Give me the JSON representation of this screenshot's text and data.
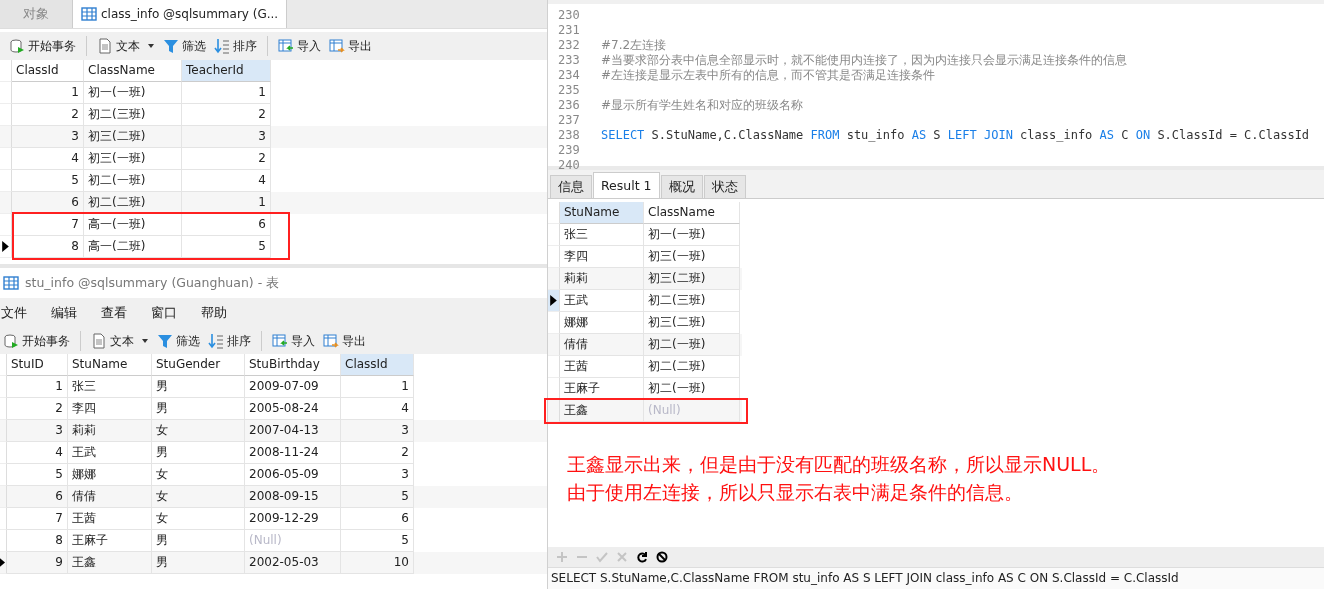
{
  "object_tabs": [
    {
      "label": "对象",
      "kind": "plain",
      "selected": false
    },
    {
      "label": "class_info @sqlsummary (G...",
      "kind": "table",
      "selected": true
    }
  ],
  "class_window": {
    "toolbar": [
      {
        "label": "开始事务",
        "kind": "transaction"
      },
      {
        "label": "文本",
        "kind": "text"
      },
      {
        "label": "筛选",
        "kind": "filter"
      },
      {
        "label": "排序",
        "kind": "sort"
      },
      {
        "label": "导入",
        "kind": "import"
      },
      {
        "label": "导出",
        "kind": "export"
      }
    ],
    "grid": {
      "columns": [
        {
          "name": "ClassId",
          "numeric": true,
          "selected": false
        },
        {
          "name": "ClassName",
          "numeric": false,
          "selected": false
        },
        {
          "name": "TeacherId",
          "numeric": true,
          "selected": true
        }
      ],
      "rows": [
        {
          "cells": [
            "1",
            "初一(一班)",
            "1"
          ],
          "selected": false,
          "highlighted": false
        },
        {
          "cells": [
            "2",
            "初二(三班)",
            "2"
          ],
          "selected": false,
          "highlighted": false
        },
        {
          "cells": [
            "3",
            "初三(二班)",
            "3"
          ],
          "selected": false,
          "highlighted": false
        },
        {
          "cells": [
            "4",
            "初三(一班)",
            "2"
          ],
          "selected": false,
          "highlighted": false
        },
        {
          "cells": [
            "5",
            "初二(一班)",
            "4"
          ],
          "selected": false,
          "highlighted": false
        },
        {
          "cells": [
            "6",
            "初二(二班)",
            "1"
          ],
          "selected": false,
          "highlighted": false
        },
        {
          "cells": [
            "7",
            "高一(一班)",
            "6"
          ],
          "selected": false,
          "highlighted": true
        },
        {
          "cells": [
            "8",
            "高一(二班)",
            "5"
          ],
          "selected": true,
          "highlighted": true
        }
      ]
    }
  },
  "stu_window": {
    "title": "stu_info @sqlsummary (Guanghuan) - 表",
    "menu": [
      "文件",
      "编辑",
      "查看",
      "窗口",
      "帮助"
    ],
    "toolbar": [
      {
        "label": "开始事务",
        "kind": "transaction"
      },
      {
        "label": "文本",
        "kind": "text"
      },
      {
        "label": "筛选",
        "kind": "filter"
      },
      {
        "label": "排序",
        "kind": "sort"
      },
      {
        "label": "导入",
        "kind": "import"
      },
      {
        "label": "导出",
        "kind": "export"
      }
    ],
    "grid": {
      "columns": [
        {
          "name": "StuID",
          "numeric": true,
          "selected": false
        },
        {
          "name": "StuName",
          "numeric": false,
          "selected": false
        },
        {
          "name": "StuGender",
          "numeric": false,
          "selected": false
        },
        {
          "name": "StuBirthday",
          "numeric": false,
          "selected": false
        },
        {
          "name": "ClassId",
          "numeric": true,
          "selected": true
        }
      ],
      "rows": [
        {
          "cells": [
            "1",
            "张三",
            "男",
            "2009-07-09",
            "1"
          ],
          "selected": false,
          "highlighted": false
        },
        {
          "cells": [
            "2",
            "李四",
            "男",
            "2005-08-24",
            "4"
          ],
          "selected": false,
          "highlighted": false
        },
        {
          "cells": [
            "3",
            "莉莉",
            "女",
            "2007-04-13",
            "3"
          ],
          "selected": false,
          "highlighted": false
        },
        {
          "cells": [
            "4",
            "王武",
            "男",
            "2008-11-24",
            "2"
          ],
          "selected": false,
          "highlighted": false
        },
        {
          "cells": [
            "5",
            "娜娜",
            "女",
            "2006-05-09",
            "3"
          ],
          "selected": false,
          "highlighted": false
        },
        {
          "cells": [
            "6",
            "倩倩",
            "女",
            "2008-09-15",
            "5"
          ],
          "selected": false,
          "highlighted": false
        },
        {
          "cells": [
            "7",
            "王茜",
            "女",
            "2009-12-29",
            "6"
          ],
          "selected": false,
          "highlighted": false
        },
        {
          "cells": [
            "8",
            "王麻子",
            "男",
            {
              "text": "(Null)",
              "kind": "null"
            },
            "5"
          ],
          "selected": false,
          "highlighted": false
        },
        {
          "cells": [
            "9",
            "王鑫",
            "男",
            "2002-05-03",
            "10"
          ],
          "selected": true,
          "highlighted": false
        }
      ]
    }
  },
  "editor": {
    "lines": [
      {
        "number": "230",
        "kind": "blank"
      },
      {
        "number": "231",
        "kind": "blank"
      },
      {
        "number": "232",
        "kind": "comment",
        "text": "#7.2左连接"
      },
      {
        "number": "233",
        "kind": "comment",
        "text": "#当要求部分表中信息全部显示时，就不能使用内连接了，因为内连接只会显示满足连接条件的信息"
      },
      {
        "number": "234",
        "kind": "comment",
        "text": "#左连接是显示左表中所有的信息，而不管其是否满足连接条件"
      },
      {
        "number": "235",
        "kind": "blank"
      },
      {
        "number": "236",
        "kind": "comment",
        "text": "#显示所有学生姓名和对应的班级名称"
      },
      {
        "number": "237",
        "kind": "blank"
      },
      {
        "number": "238",
        "kind": "code",
        "tokens": [
          {
            "text": "SELECT",
            "keyword": true
          },
          {
            "text": " S.StuName,C.ClassName ",
            "keyword": false
          },
          {
            "text": "FROM",
            "keyword": true
          },
          {
            "text": " stu_info ",
            "keyword": false
          },
          {
            "text": "AS",
            "keyword": true
          },
          {
            "text": " S ",
            "keyword": false
          },
          {
            "text": "LEFT JOIN",
            "keyword": true
          },
          {
            "text": " class_info ",
            "keyword": false
          },
          {
            "text": "AS",
            "keyword": true
          },
          {
            "text": " C ",
            "keyword": false
          },
          {
            "text": "ON",
            "keyword": true
          },
          {
            "text": " S.ClassId = C.ClassId",
            "keyword": false
          }
        ]
      },
      {
        "number": "239",
        "kind": "blank"
      },
      {
        "number": "240",
        "kind": "blank"
      }
    ]
  },
  "result_tabs": [
    {
      "label": "信息",
      "selected": false
    },
    {
      "label": "Result 1",
      "selected": true
    },
    {
      "label": "概况",
      "selected": false
    },
    {
      "label": "状态",
      "selected": false
    }
  ],
  "result_grid": {
    "columns": [
      {
        "name": "StuName",
        "numeric": false,
        "selected": true
      },
      {
        "name": "ClassName",
        "numeric": false,
        "selected": false
      }
    ],
    "rows": [
      {
        "cells": [
          "张三",
          "初一(一班)"
        ],
        "selected": false,
        "highlighted": false
      },
      {
        "cells": [
          "李四",
          "初三(一班)"
        ],
        "selected": false,
        "highlighted": false
      },
      {
        "cells": [
          "莉莉",
          "初三(二班)"
        ],
        "selected": false,
        "highlighted": false
      },
      {
        "cells": [
          "王武",
          "初二(三班)"
        ],
        "selected": true,
        "highlighted": false
      },
      {
        "cells": [
          "娜娜",
          "初三(二班)"
        ],
        "selected": false,
        "highlighted": false
      },
      {
        "cells": [
          "倩倩",
          "初二(一班)"
        ],
        "selected": false,
        "highlighted": false
      },
      {
        "cells": [
          "王茜",
          "初二(二班)"
        ],
        "selected": false,
        "highlighted": false
      },
      {
        "cells": [
          "王麻子",
          "初二(一班)"
        ],
        "selected": false,
        "highlighted": false
      },
      {
        "cells": [
          "王鑫",
          {
            "text": "(Null)",
            "kind": "null"
          }
        ],
        "selected": false,
        "highlighted": true
      }
    ]
  },
  "annotation": [
    "王鑫显示出来，但是由于没有匹配的班级名称，所以显示NULL。",
    "由于使用左连接，所以只显示右表中满足条件的信息。"
  ],
  "result_toolbar": [
    {
      "kind": "add",
      "disabled": true
    },
    {
      "kind": "remove",
      "disabled": true
    },
    {
      "kind": "apply",
      "disabled": true
    },
    {
      "kind": "cancel",
      "disabled": true
    },
    {
      "kind": "refresh",
      "disabled": false
    },
    {
      "kind": "stop",
      "disabled": false
    }
  ],
  "status_bar": "SELECT S.StuName,C.ClassName FROM stu_info AS S LEFT JOIN class_info AS C ON S.ClassId = C.ClassId"
}
